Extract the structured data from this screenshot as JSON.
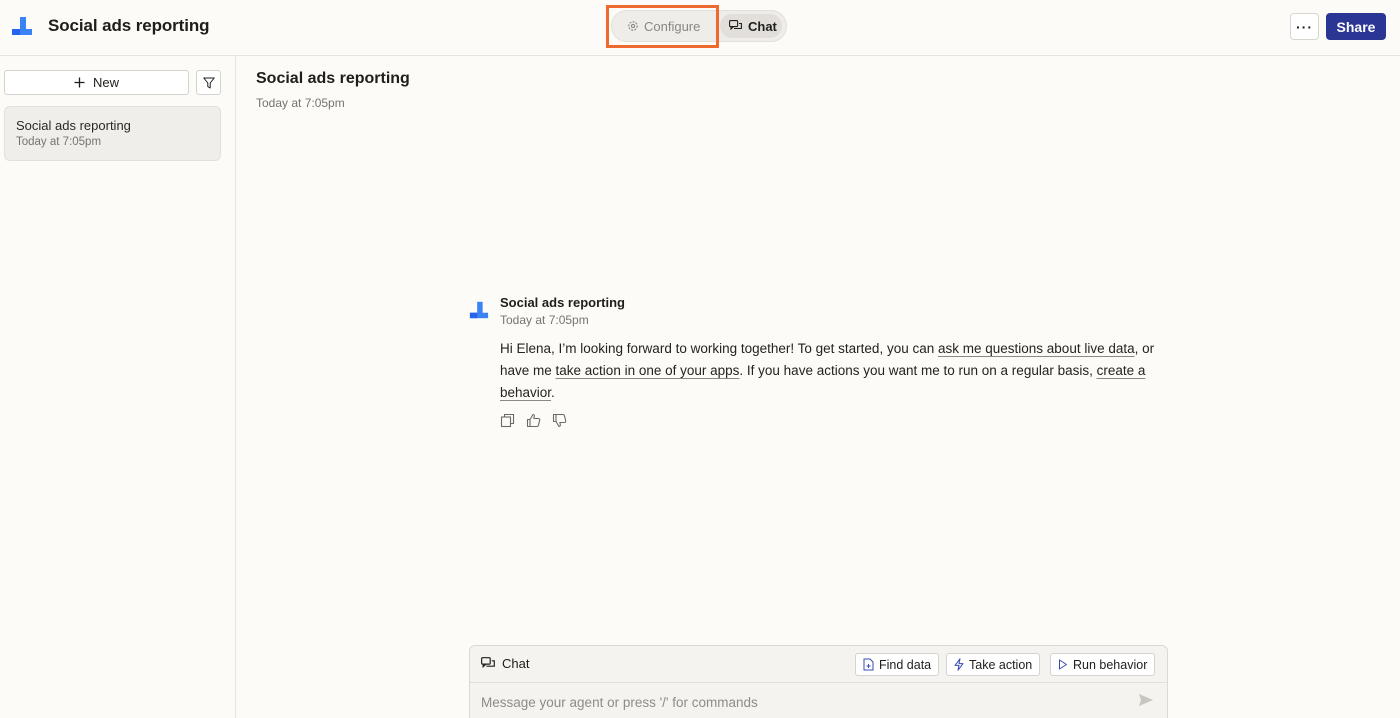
{
  "header": {
    "app_title": "Social ads reporting",
    "configure_label": "Configure",
    "chat_label": "Chat",
    "more_label": "···",
    "share_label": "Share"
  },
  "sidebar": {
    "new_label": "New",
    "conversations": [
      {
        "title": "Social ads reporting",
        "time": "Today at 7:05pm"
      }
    ]
  },
  "main": {
    "title": "Social ads reporting",
    "time": "Today at 7:05pm",
    "message": {
      "author": "Social ads reporting",
      "time": "Today at 7:05pm",
      "text_1": "Hi Elena, I’m looking forward to working together! To get started, you can ",
      "link_1": "ask me questions about live data",
      "text_2": ", or have me ",
      "link_2": "take action in one of your apps",
      "text_3": ". If you have actions you want me to run on a regular basis, ",
      "link_3": "create a behavior",
      "text_4": "."
    }
  },
  "composer": {
    "label": "Chat",
    "find_data": "Find data",
    "take_action": "Take action",
    "run_behavior": "Run behavior",
    "placeholder": "Message your agent or press '/' for commands"
  },
  "colors": {
    "accent": "#2b3594",
    "highlight": "#ef6a2f",
    "logo_blue": "#3b82f6"
  }
}
